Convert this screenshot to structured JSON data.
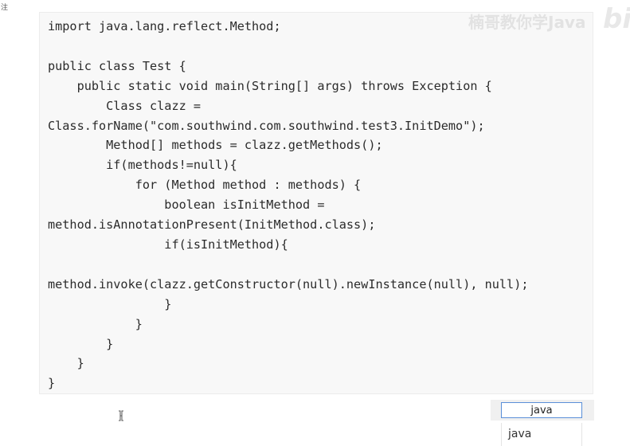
{
  "corner_label": "注",
  "code": {
    "lines": [
      "import java.lang.reflect.Method;",
      "",
      "public class Test {",
      "    public static void main(String[] args) throws Exception {",
      "        Class clazz =",
      "Class.forName(\"com.southwind.com.southwind.test3.InitDemo\");",
      "        Method[] methods = clazz.getMethods();",
      "        if(methods!=null){",
      "            for (Method method : methods) {",
      "                boolean isInitMethod =",
      "method.isAnnotationPresent(InitMethod.class);",
      "                if(isInitMethod){",
      "",
      "method.invoke(clazz.getConstructor(null).newInstance(null), null);",
      "                }",
      "            }",
      "        }",
      "    }",
      "}"
    ]
  },
  "watermark": {
    "text": "楠哥教你学Java",
    "logo": "bili"
  },
  "search": {
    "value": "java",
    "suggestions": [
      "java"
    ]
  },
  "icons": {
    "text_cursor": "text-cursor-icon"
  }
}
